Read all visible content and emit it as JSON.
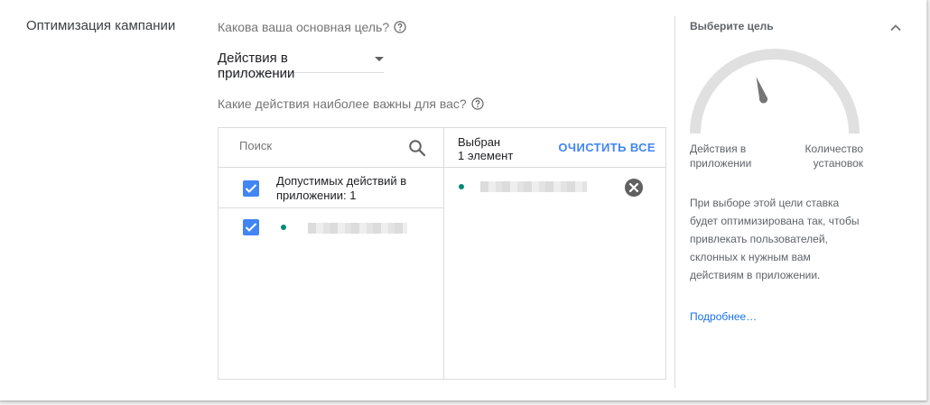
{
  "section": {
    "title": "Оптимизация кампании"
  },
  "goal_question": {
    "text": "Какова ваша основная цель?",
    "help_icon": "help-circle-icon"
  },
  "goal_dropdown": {
    "value": "Действия в приложении",
    "icon": "arrow-drop-down-icon"
  },
  "actions_question": {
    "text": "Какие действия наиболее важны для вас?",
    "help_icon": "help-circle-icon"
  },
  "picker": {
    "search": {
      "placeholder": "Поиск",
      "icon": "search-icon"
    },
    "group": {
      "label": "Допустимых действий в приложении: 1",
      "checked": true
    },
    "items": [
      {
        "checked": true,
        "status_color": "#00897b"
      }
    ],
    "selected": {
      "title": "Выбран",
      "count": "1 элемент",
      "clear_label": "ОЧИСТИТЬ ВСЕ",
      "items": [
        {
          "status_color": "#00897b",
          "remove_icon": "cancel-circle-icon"
        }
      ]
    }
  },
  "goal_panel": {
    "title": "Выберите цель",
    "collapse_icon": "chevron-up-icon",
    "gauge": {
      "left_label": "Действия в приложении",
      "right_label": "Количество установок",
      "level": 0.4
    },
    "description": "При выборе этой цели ставка будет оптимизирована так, чтобы привлекать пользователей, склонных к нужным вам действиям в приложении.",
    "learn_more": "Подробнее…"
  },
  "colors": {
    "accent": "#4285f4",
    "link": "#1a73e8",
    "status_dot": "#00897b",
    "gauge_track": "#e0e0e0",
    "gauge_needle": "#757575"
  }
}
